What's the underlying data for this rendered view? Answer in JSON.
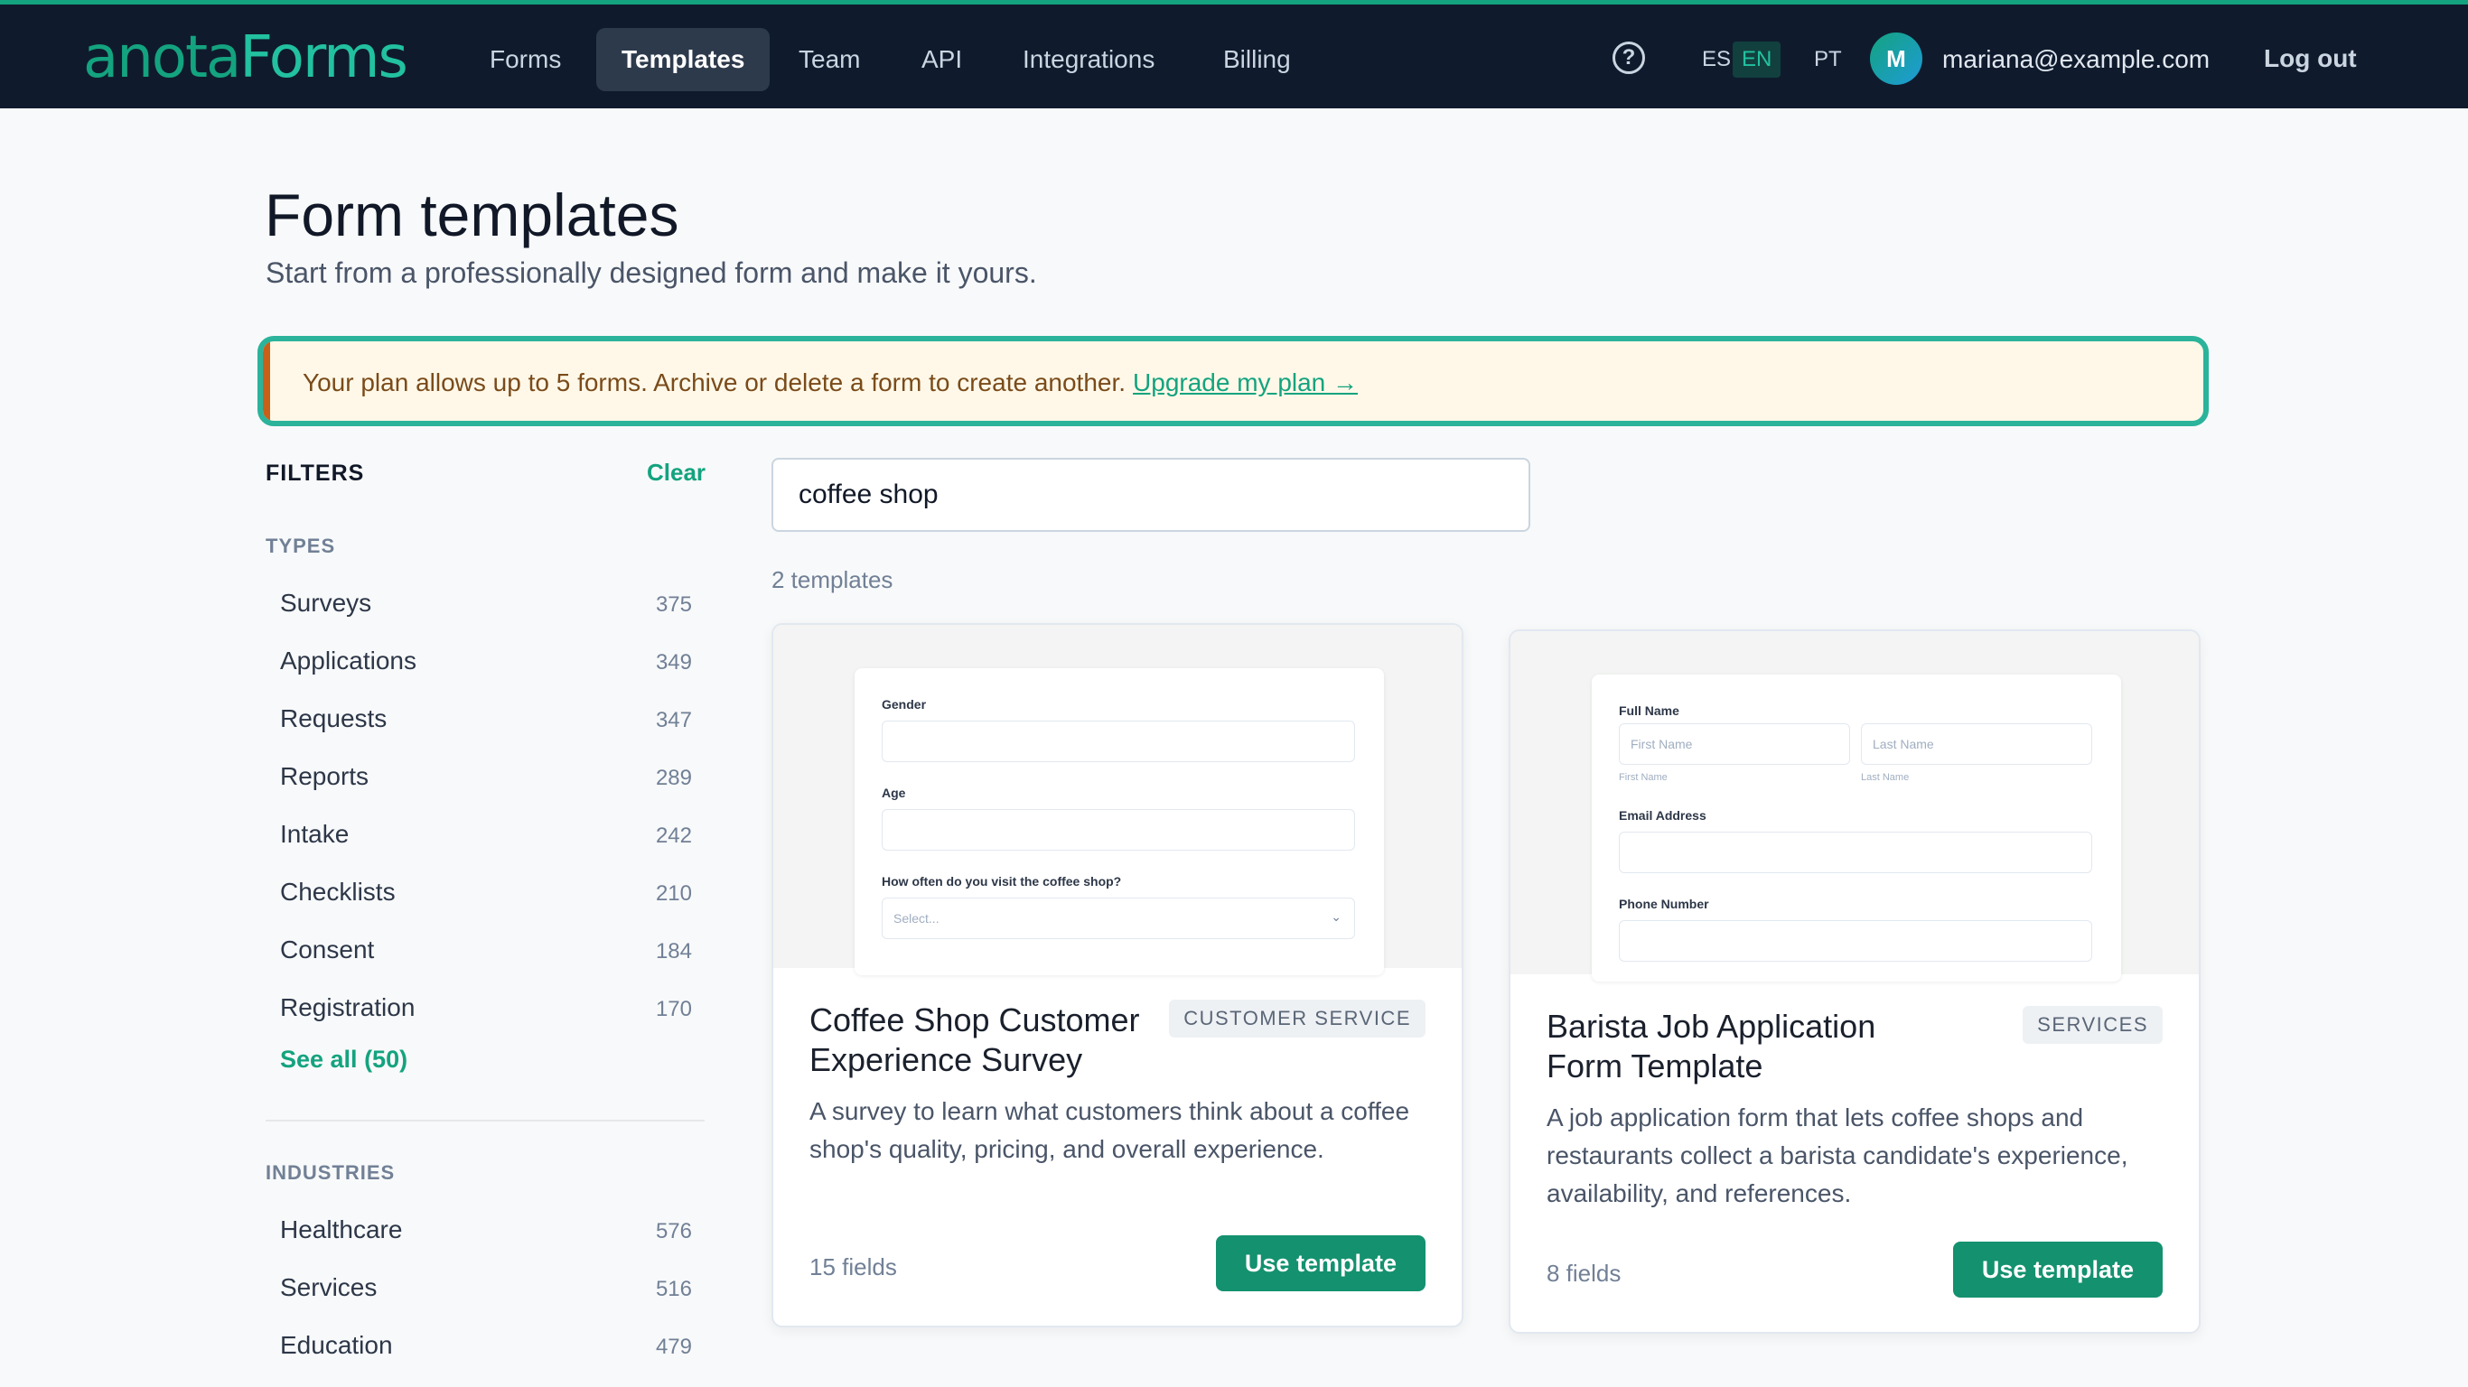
{
  "app": {
    "logo": {
      "part1": "anota",
      "part2": "Forms"
    },
    "nav": [
      "Forms",
      "Templates",
      "Team",
      "API",
      "Integrations",
      "Billing"
    ],
    "active_nav": "Templates",
    "help_icon": "?",
    "languages": [
      "ES",
      "EN",
      "PT"
    ],
    "active_language": "EN",
    "user": {
      "initial": "M",
      "email": "mariana@example.com"
    },
    "logout_label": "Log out"
  },
  "page": {
    "title": "Form templates",
    "subtitle": "Start from a professionally designed form and make it yours."
  },
  "banner": {
    "text": "Your plan allows up to 5 forms. Archive or delete a form to create another.",
    "link": "Upgrade my plan →"
  },
  "filters": {
    "title": "FILTERS",
    "clear": "Clear",
    "types_title": "TYPES",
    "types": [
      {
        "label": "Surveys",
        "count": "375"
      },
      {
        "label": "Applications",
        "count": "349"
      },
      {
        "label": "Requests",
        "count": "347"
      },
      {
        "label": "Reports",
        "count": "289"
      },
      {
        "label": "Intake",
        "count": "242"
      },
      {
        "label": "Checklists",
        "count": "210"
      },
      {
        "label": "Consent",
        "count": "184"
      },
      {
        "label": "Registration",
        "count": "170"
      }
    ],
    "see_all": "See all (50)",
    "industries_title": "INDUSTRIES",
    "industries": [
      {
        "label": "Healthcare",
        "count": "576"
      },
      {
        "label": "Services",
        "count": "516"
      },
      {
        "label": "Education",
        "count": "479"
      }
    ]
  },
  "search": {
    "value": "coffee shop"
  },
  "results": {
    "count_label": "2 templates"
  },
  "cards": [
    {
      "title": "Coffee Shop Customer Experience Survey",
      "tag": "CUSTOMER SERVICE",
      "description": "A survey to learn what customers think about a coffee shop's quality, pricing, and overall experience.",
      "fields": "15 fields",
      "button": "Use template",
      "preview": {
        "l1": "Gender",
        "l2": "Age",
        "l3": "How often do you visit the coffee shop?",
        "select_ph": "Select..."
      }
    },
    {
      "title": "Barista Job Application Form Template",
      "tag": "SERVICES",
      "description": "A job application form that lets coffee shops and restaurants collect a barista candidate's experience, availability, and references.",
      "fields": "8 fields",
      "button": "Use template",
      "preview": {
        "l1": "Full Name",
        "first_ph": "First Name",
        "last_ph": "Last Name",
        "first_sub": "First Name",
        "last_sub": "Last Name",
        "l2": "Email Address",
        "l3": "Phone Number"
      }
    }
  ],
  "colors": {
    "accent": "#14a37f",
    "nav_bg": "#0f1b2d",
    "banner_border": "#2bb39b",
    "banner_bg": "#fff8e8"
  }
}
